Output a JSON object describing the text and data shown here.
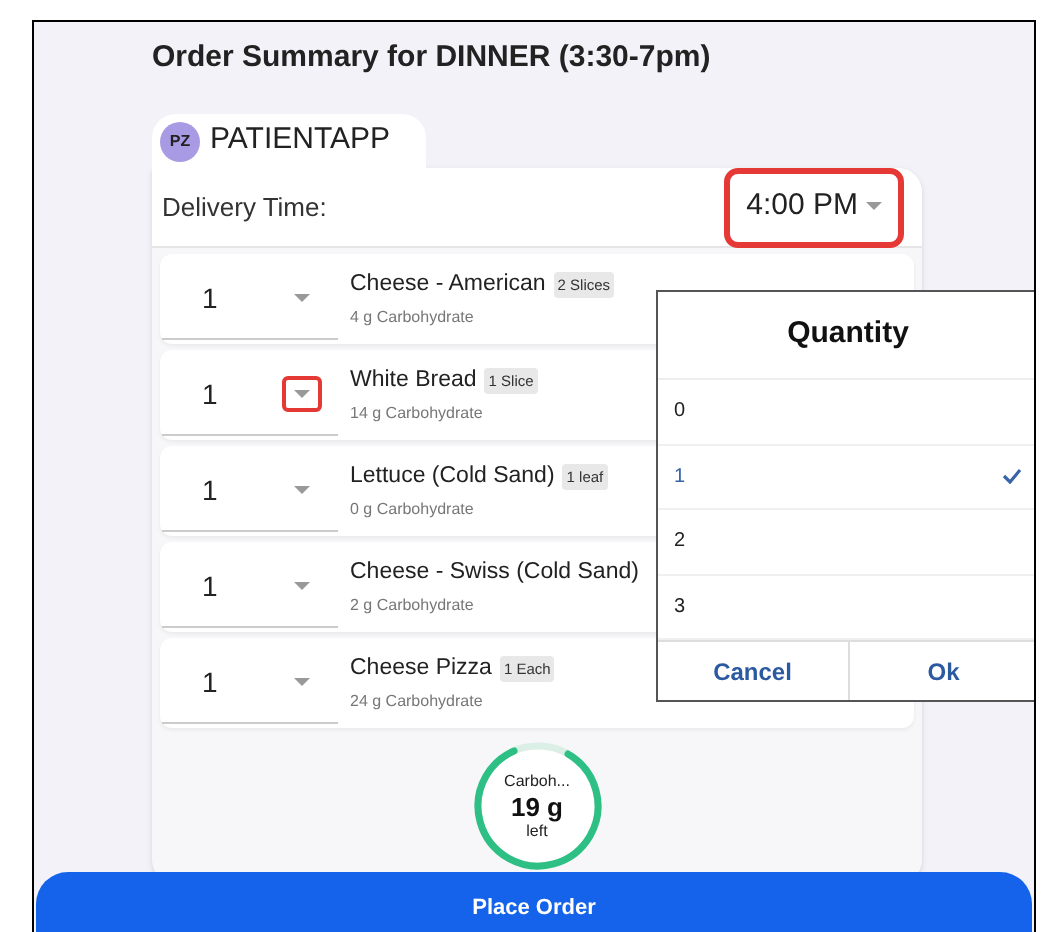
{
  "title": "Order Summary for DINNER (3:30-7pm)",
  "account": {
    "initials": "PZ",
    "name": "PATIENTAPP"
  },
  "delivery": {
    "label": "Delivery Time:",
    "value": "4:00 PM",
    "highlighted": true
  },
  "items": [
    {
      "quantity": "1",
      "name": "Cheese - American",
      "unit": "2 Slices",
      "carbs": "4 g Carbohydrate",
      "highlighted": false
    },
    {
      "quantity": "1",
      "name": "White Bread",
      "unit": "1 Slice",
      "carbs": "14 g Carbohydrate",
      "highlighted": true
    },
    {
      "quantity": "1",
      "name": "Lettuce (Cold Sand)",
      "unit": "1 leaf",
      "carbs": "0 g Carbohydrate",
      "highlighted": false
    },
    {
      "quantity": "1",
      "name": "Cheese - Swiss (Cold Sand)",
      "carbs": "2 g Carbohydrate",
      "highlighted": false
    },
    {
      "quantity": "1",
      "name": "Cheese Pizza",
      "unit": "1 Each",
      "carbs": "24 g Carbohydrate",
      "highlighted": false
    }
  ],
  "carb_meter": {
    "label": "Carboh...",
    "amount": "19 g",
    "caption": "left",
    "level": 0.85
  },
  "quantity_dialog": {
    "title": "Quantity",
    "options": [
      {
        "label": "0",
        "selected": false
      },
      {
        "label": "1",
        "selected": true
      },
      {
        "label": "2",
        "selected": false
      },
      {
        "label": "3",
        "selected": false
      }
    ],
    "buttons": [
      "Cancel",
      "Ok"
    ]
  },
  "place_order": "Place Order"
}
